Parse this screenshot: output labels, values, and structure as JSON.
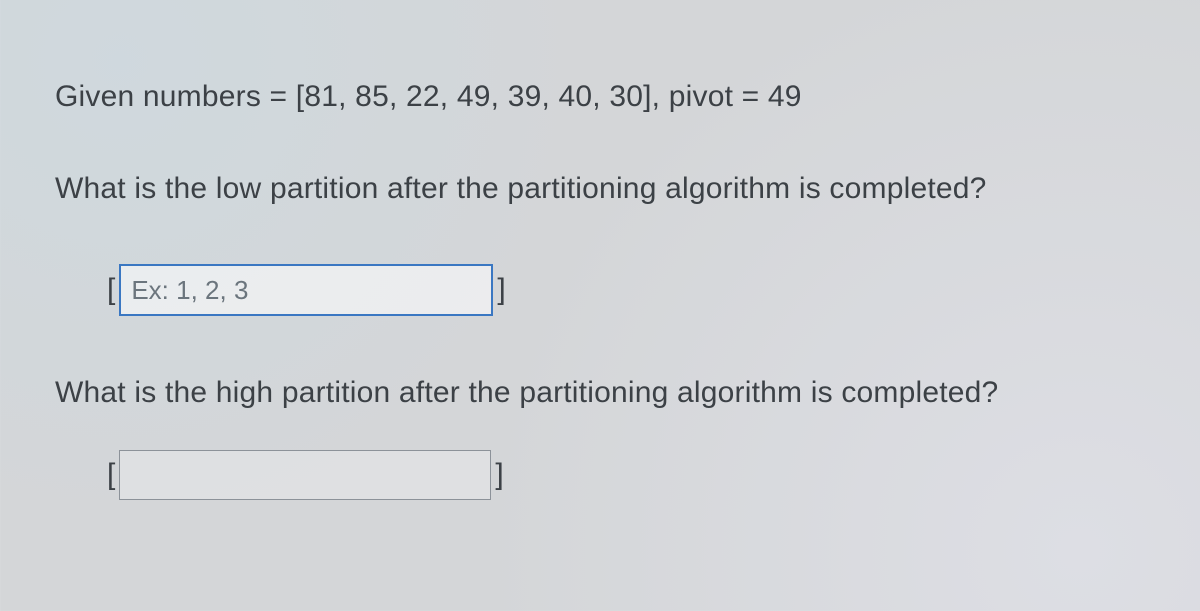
{
  "problem": {
    "given_line": "Given numbers = [81, 85, 22, 49, 39, 40, 30], pivot = 49",
    "numbers": [
      81,
      85,
      22,
      49,
      39,
      40,
      30
    ],
    "pivot": 49
  },
  "questions": {
    "low": {
      "prompt": "What is the low partition after the partitioning algorithm is completed?",
      "open_bracket": "[",
      "close_bracket": "]",
      "placeholder": "Ex: 1, 2, 3",
      "value": ""
    },
    "high": {
      "prompt": "What is the high partition after the partitioning algorithm is completed?",
      "open_bracket": "[",
      "close_bracket": "]",
      "placeholder": "",
      "value": ""
    }
  }
}
